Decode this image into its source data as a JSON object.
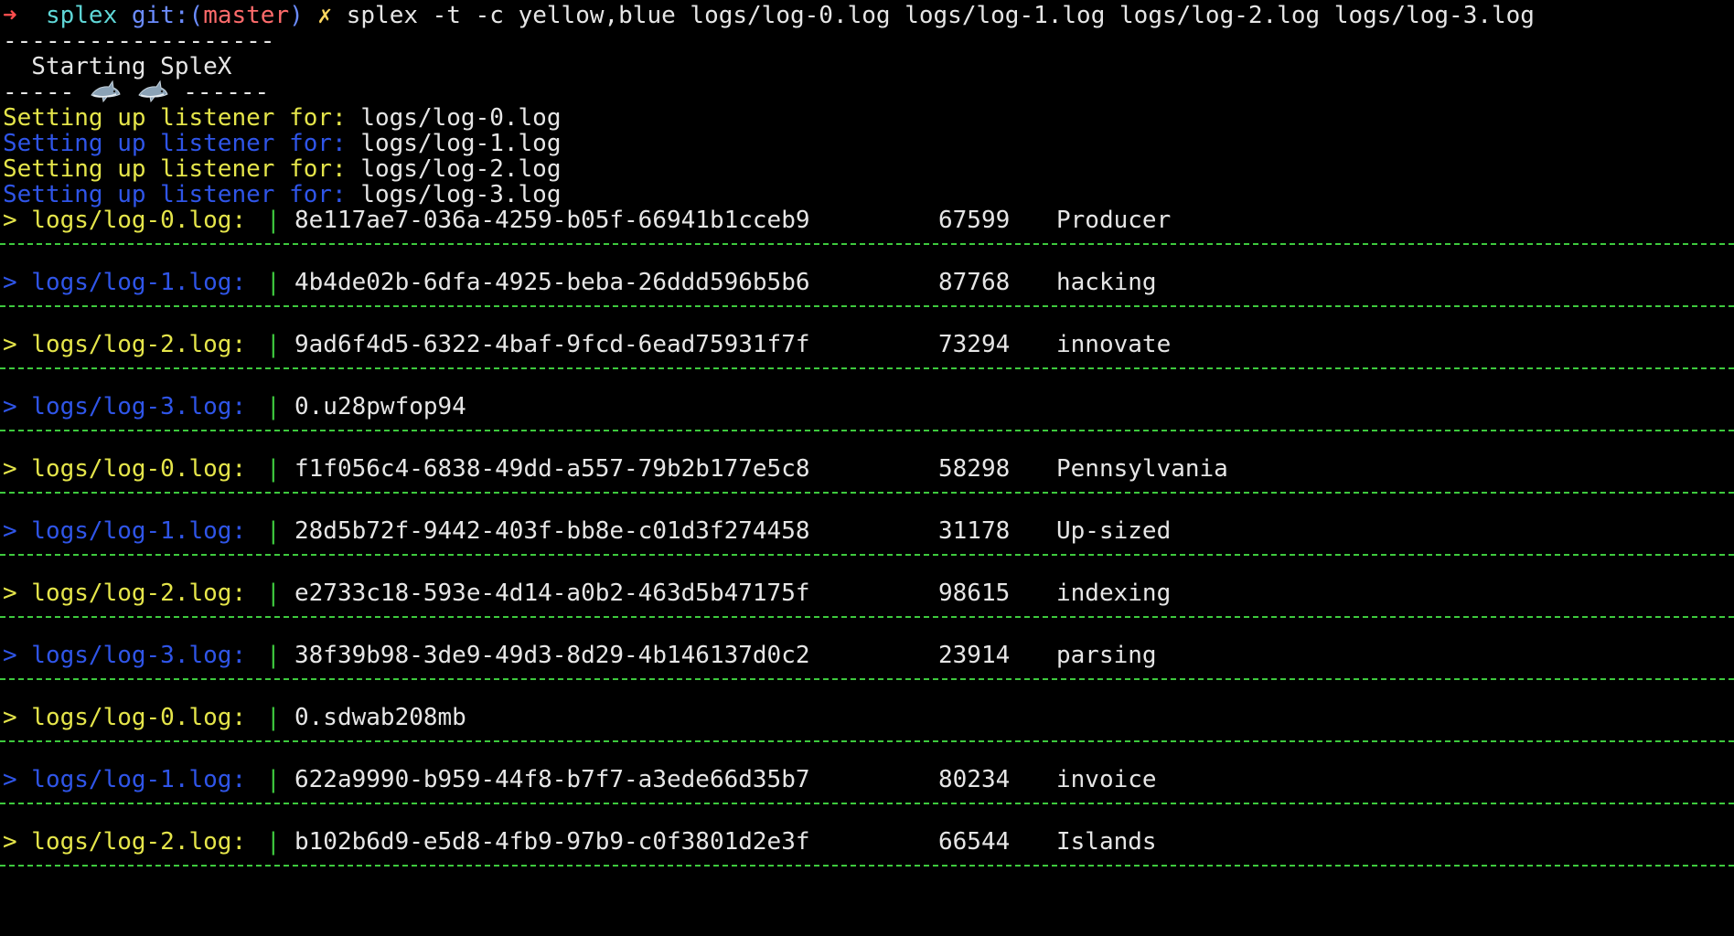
{
  "colors": {
    "yellow": "#e5e54a",
    "blue": "#2f55e8",
    "green": "#3ec93e",
    "prompt_arrow": "#ff4d4d",
    "prompt_dir": "#5fd7d7",
    "prompt_git": "#6b8cff"
  },
  "prompt": {
    "arrow": "➜",
    "directory": "splex",
    "git_label": "git:(",
    "branch": "master",
    "git_close": ")",
    "dirty_marker": "✗",
    "command": "splex -t -c yellow,blue logs/log-0.log logs/log-1.log logs/log-2.log logs/log-3.log"
  },
  "banner": {
    "top_rule": "-------------------",
    "title": "  Starting SpleX",
    "bottom_rule_left": "----- ",
    "bottom_rule_right": " ------",
    "icons": [
      "shark-icon",
      "shark-icon"
    ]
  },
  "listeners": [
    {
      "label": "Setting up listener for: ",
      "file": "logs/log-0.log",
      "color": "yellow"
    },
    {
      "label": "Setting up listener for: ",
      "file": "logs/log-1.log",
      "color": "blue"
    },
    {
      "label": "Setting up listener for: ",
      "file": "logs/log-2.log",
      "color": "yellow"
    },
    {
      "label": "Setting up listener for: ",
      "file": "logs/log-3.log",
      "color": "blue"
    }
  ],
  "log_entries": [
    {
      "prefix": "> logs/log-0.log: ",
      "pipe": "|",
      "id": "8e117ae7-036a-4259-b05f-66941b1cceb9",
      "number": "67599",
      "word": "Producer",
      "color": "yellow"
    },
    {
      "prefix": "> logs/log-1.log: ",
      "pipe": "|",
      "id": "4b4de02b-6dfa-4925-beba-26ddd596b5b6",
      "number": "87768",
      "word": "hacking",
      "color": "blue"
    },
    {
      "prefix": "> logs/log-2.log: ",
      "pipe": "|",
      "id": "9ad6f4d5-6322-4baf-9fcd-6ead75931f7f",
      "number": "73294",
      "word": "innovate",
      "color": "yellow"
    },
    {
      "prefix": "> logs/log-3.log: ",
      "pipe": "|",
      "id": "0.u28pwfop94",
      "number": "",
      "word": "",
      "color": "blue"
    },
    {
      "prefix": "> logs/log-0.log: ",
      "pipe": "|",
      "id": "f1f056c4-6838-49dd-a557-79b2b177e5c8",
      "number": "58298",
      "word": "Pennsylvania",
      "color": "yellow"
    },
    {
      "prefix": "> logs/log-1.log: ",
      "pipe": "|",
      "id": "28d5b72f-9442-403f-bb8e-c01d3f274458",
      "number": "31178",
      "word": "Up-sized",
      "color": "blue"
    },
    {
      "prefix": "> logs/log-2.log: ",
      "pipe": "|",
      "id": "e2733c18-593e-4d14-a0b2-463d5b47175f",
      "number": "98615",
      "word": "indexing",
      "color": "yellow"
    },
    {
      "prefix": "> logs/log-3.log: ",
      "pipe": "|",
      "id": "38f39b98-3de9-49d3-8d29-4b146137d0c2",
      "number": "23914",
      "word": "parsing",
      "color": "blue"
    },
    {
      "prefix": "> logs/log-0.log: ",
      "pipe": "|",
      "id": "0.sdwab208mb",
      "number": "",
      "word": "",
      "color": "yellow"
    },
    {
      "prefix": "> logs/log-1.log: ",
      "pipe": "|",
      "id": "622a9990-b959-44f8-b7f7-a3ede66d35b7",
      "number": "80234",
      "word": "invoice",
      "color": "blue"
    },
    {
      "prefix": "> logs/log-2.log: ",
      "pipe": "|",
      "id": "b102b6d9-e5d8-4fb9-97b9-c0f3801d2e3f",
      "number": "66544",
      "word": "Islands",
      "color": "yellow"
    }
  ]
}
